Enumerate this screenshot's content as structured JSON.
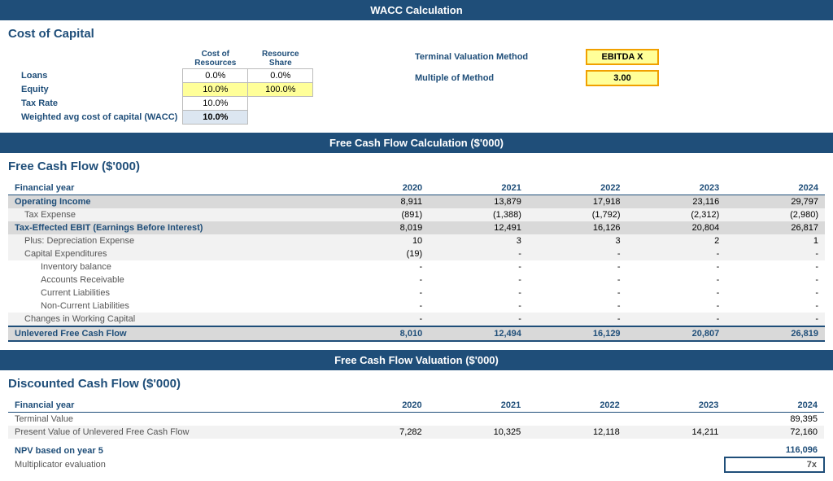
{
  "page": {
    "wacc_header": "WACC Calculation",
    "fcf_header": "Free Cash Flow Calculation ($'000)",
    "val_header": "Free Cash Flow Valuation ($'000)"
  },
  "cost_of_capital": {
    "title": "Cost of Capital",
    "col1": "Cost of",
    "col1b": "Resources",
    "col2": "Resource",
    "col2b": "Share",
    "rows": [
      {
        "label": "Loans",
        "cost": "0.0%",
        "share": "0.0%"
      },
      {
        "label": "Equity",
        "cost": "10.0%",
        "share": "100.0%"
      },
      {
        "label": "Tax Rate",
        "cost": "10.0%",
        "share": ""
      },
      {
        "label": "Weighted avg cost of capital (WACC)",
        "cost": "10.0%",
        "share": ""
      }
    ],
    "terminal_label1": "Terminal Valuation Method",
    "terminal_value1": "EBITDA X",
    "terminal_label2": "Multiple of Method",
    "terminal_value2": "3.00"
  },
  "fcf": {
    "title": "Free Cash Flow ($'000)",
    "years": [
      "2020",
      "2021",
      "2022",
      "2023",
      "2024"
    ],
    "rows": [
      {
        "label": "Financial year",
        "indent": 0,
        "bold": true,
        "header": true,
        "values": [
          "2020",
          "2021",
          "2022",
          "2023",
          "2024"
        ]
      },
      {
        "label": "Operating Income",
        "indent": 0,
        "bold": true,
        "style": "gray",
        "values": [
          "8,911",
          "13,879",
          "17,918",
          "23,116",
          "29,797"
        ]
      },
      {
        "label": "Tax Expense",
        "indent": 1,
        "bold": false,
        "style": "light",
        "values": [
          "(891)",
          "(1,388)",
          "(1,792)",
          "(2,312)",
          "(2,980)"
        ]
      },
      {
        "label": "Tax-Effected EBIT (Earnings Before Interest)",
        "indent": 0,
        "bold": true,
        "style": "gray",
        "values": [
          "8,019",
          "12,491",
          "16,126",
          "20,804",
          "26,817"
        ]
      },
      {
        "label": "Plus: Depreciation Expense",
        "indent": 1,
        "bold": false,
        "style": "light",
        "values": [
          "10",
          "3",
          "3",
          "2",
          "1"
        ]
      },
      {
        "label": "Capital Expenditures",
        "indent": 1,
        "bold": false,
        "style": "light",
        "values": [
          "(19)",
          "-",
          "-",
          "-",
          "-"
        ]
      },
      {
        "label": "Inventory balance",
        "indent": 2,
        "bold": false,
        "style": "white",
        "values": [
          "-",
          "-",
          "-",
          "-",
          "-"
        ]
      },
      {
        "label": "Accounts Receivable",
        "indent": 2,
        "bold": false,
        "style": "white",
        "values": [
          "-",
          "-",
          "-",
          "-",
          "-"
        ]
      },
      {
        "label": "Current Liabilities",
        "indent": 2,
        "bold": false,
        "style": "white",
        "values": [
          "-",
          "-",
          "-",
          "-",
          "-"
        ]
      },
      {
        "label": "Non-Current Liabilities",
        "indent": 2,
        "bold": false,
        "style": "white",
        "values": [
          "-",
          "-",
          "-",
          "-",
          "-"
        ]
      },
      {
        "label": "Changes in Working Capital",
        "indent": 1,
        "bold": false,
        "style": "light",
        "values": [
          "-",
          "-",
          "-",
          "-",
          "-"
        ]
      },
      {
        "label": "Unlevered Free Cash Flow",
        "indent": 0,
        "bold": true,
        "style": "total",
        "values": [
          "8,010",
          "12,494",
          "16,129",
          "20,807",
          "26,819"
        ]
      }
    ]
  },
  "dcf": {
    "title": "Discounted Cash Flow ($'000)",
    "rows": [
      {
        "label": "Financial year",
        "indent": 0,
        "bold": true,
        "header": true,
        "values": [
          "2020",
          "2021",
          "2022",
          "2023",
          "2024"
        ]
      },
      {
        "label": "Terminal Value",
        "indent": 0,
        "bold": false,
        "normal": true,
        "style": "white",
        "values": [
          "",
          "",
          "",
          "",
          "89,395"
        ]
      },
      {
        "label": "Present Value of Unlevered Free Cash Flow",
        "indent": 0,
        "bold": false,
        "normal": true,
        "style": "light",
        "values": [
          "7,282",
          "10,325",
          "12,118",
          "14,211",
          "72,160"
        ]
      }
    ],
    "npv_label": "NPV based on year 5",
    "npv_value": "116,096",
    "mult_label": "Multiplicator evaluation",
    "mult_value": "7x"
  }
}
